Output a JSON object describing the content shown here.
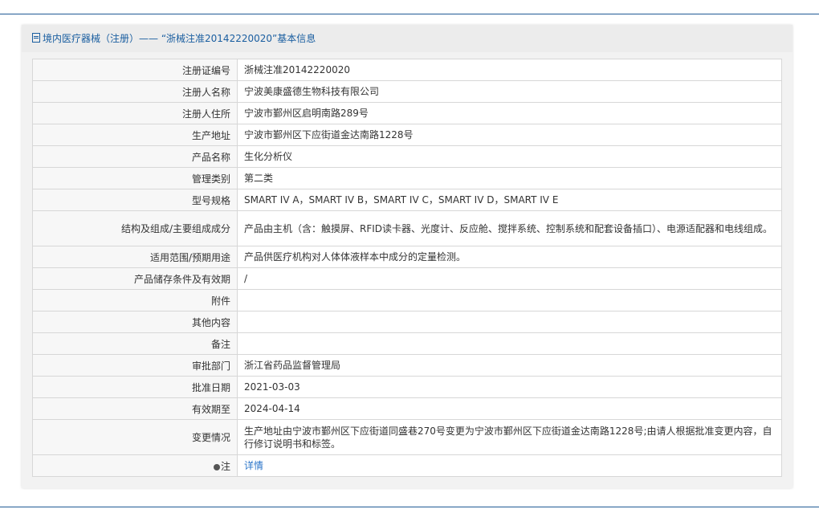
{
  "header": {
    "title": "境内医疗器械（注册）—— “浙械注准20142220020”基本信息"
  },
  "rows": [
    {
      "label": "注册证编号",
      "value": "浙械注准20142220020"
    },
    {
      "label": "注册人名称",
      "value": "宁波美康盛德生物科技有限公司"
    },
    {
      "label": "注册人住所",
      "value": "宁波市鄞州区启明南路289号"
    },
    {
      "label": "生产地址",
      "value": "宁波市鄞州区下应街道金达南路1228号"
    },
    {
      "label": "产品名称",
      "value": "生化分析仪"
    },
    {
      "label": "管理类别",
      "value": "第二类"
    },
    {
      "label": "型号规格",
      "value": "SMART IV A，SMART IV B，SMART IV C，SMART IV D，SMART IV E"
    },
    {
      "label": "结构及组成/主要组成成分",
      "value": "产品由主机（含：触摸屏、RFID读卡器、光度计、反应舱、搅拌系统、控制系统和配套设备插口）、电源适配器和电线组成。"
    },
    {
      "label": "适用范围/预期用途",
      "value": "产品供医疗机构对人体体液样本中成分的定量检测。"
    },
    {
      "label": "产品储存条件及有效期",
      "value": "/"
    },
    {
      "label": "附件",
      "value": ""
    },
    {
      "label": "其他内容",
      "value": ""
    },
    {
      "label": "备注",
      "value": ""
    },
    {
      "label": "审批部门",
      "value": "浙江省药品监督管理局"
    },
    {
      "label": "批准日期",
      "value": "2021-03-03"
    },
    {
      "label": "有效期至",
      "value": "2024-04-14"
    },
    {
      "label": "变更情况",
      "value": "生产地址由宁波市鄞州区下应街道同盛巷270号变更为宁波市鄞州区下应街道金达南路1228号;由请人根据批准变更内容，自行修订说明书和标签。"
    },
    {
      "label": "注",
      "value": "详情"
    }
  ],
  "icons": {
    "header": "document-icon",
    "note": "bulb-icon"
  },
  "colors": {
    "accent": "#1a5ea0",
    "link": "#2a74c9"
  }
}
